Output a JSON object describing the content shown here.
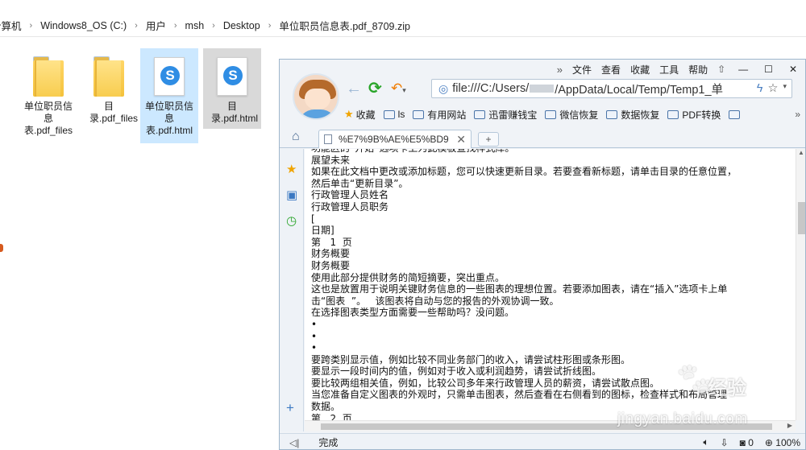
{
  "explorer": {
    "breadcrumb": [
      "计算机",
      "Windows8_OS (C:)",
      "用户",
      "msh",
      "Desktop",
      "单位职员信息表.pdf_8709.zip"
    ],
    "files": [
      {
        "label": "单位职员信息表.pdf_files",
        "kind": "folder"
      },
      {
        "label": "目录.pdf_files",
        "kind": "folder"
      },
      {
        "label": "单位职员信息表.pdf.html",
        "kind": "html"
      },
      {
        "label": "目录.pdf.html",
        "kind": "html"
      }
    ]
  },
  "browser": {
    "menu": [
      "»",
      "文件",
      "查看",
      "收藏",
      "工具",
      "帮助"
    ],
    "address": "file:///C:/Users/",
    "address_tail": "/AppData/Local/Temp/Temp1_单",
    "bookmarks": [
      "收藏",
      "ls",
      "有用网站",
      "迅雷赚钱宝",
      "微信恢复",
      "数据恢复",
      "PDF转换"
    ],
    "tab_title": "%E7%9B%AE%E5%BD9",
    "status_text": "完成",
    "status_count": "0",
    "zoom": "100%",
    "content_lines": [
      "功能区的“开始”选项卡上为此模板查找样式库。",
      "展望未来",
      "如果在此文档中更改或添加标题，您可以快速更新目录。若要查看新标题，请单击目录的任意位置，",
      "然后单击“更新目录”。",
      "行政管理人员姓名",
      "行政管理人员职务",
      "[",
      "日期]",
      "第   1  页",
      "财务概要",
      "财务概要",
      "使用此部分提供财务的简短摘要，突出重点。",
      "这也是放置用于说明关键财务信息的一些图表的理想位置。若要添加图表，请在“插入”选项卡上单",
      "击“图表  ”。   该图表将自动与您的报告的外观协调一致。",
      "在选择图表类型方面需要一些帮助吗？没问题。",
      "•",
      "•",
      "•",
      "要跨类别显示值，例如比较不同业务部门的收入，请尝试柱形图或条形图。",
      "要显示一段时间内的值，例如对于收入或利润趋势，请尝试折线图。",
      "要比较两组相关值，例如，比较公司多年来行政管理人员的薪资，请尝试散点图。",
      "当您准备自定义图表的外观时，只需单击图表，然后查看在右侧看到的图标，检查样式和布局管理",
      "数据。",
      "第   2  页"
    ]
  },
  "watermark": {
    "brand": "经验",
    "url": "jingyan.baidu.com"
  },
  "colors": {
    "accent": "#2f8de4",
    "folder": "#f4c23c",
    "selection": "#cce8ff"
  }
}
